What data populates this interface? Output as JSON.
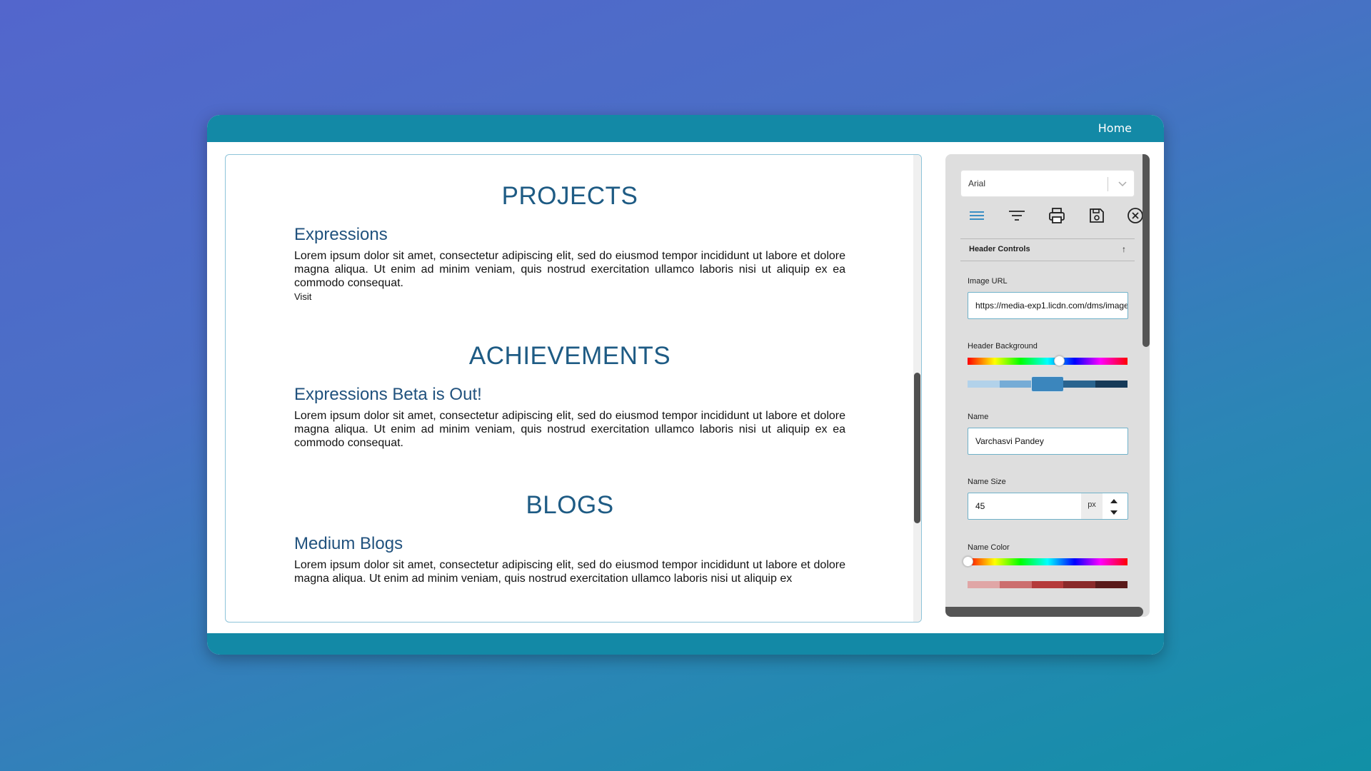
{
  "nav": {
    "home_label": "Home"
  },
  "preview": {
    "sections": [
      {
        "title": "PROJECTS",
        "items": [
          {
            "title": "Expressions",
            "text": "Lorem ipsum dolor sit amet, consectetur adipiscing elit, sed do eiusmod tempor incididunt ut labore et dolore magna aliqua. Ut enim ad minim veniam, quis nostrud exercitation ullamco laboris nisi ut aliquip ex ea commodo consequat.",
            "link": "Visit"
          }
        ]
      },
      {
        "title": "ACHIEVEMENTS",
        "items": [
          {
            "title": "Expressions Beta is Out!",
            "text": "Lorem ipsum dolor sit amet, consectetur adipiscing elit, sed do eiusmod tempor incididunt ut labore et dolore magna aliqua. Ut enim ad minim veniam, quis nostrud exercitation ullamco laboris nisi ut aliquip ex ea commodo consequat."
          }
        ]
      },
      {
        "title": "BLOGS",
        "items": [
          {
            "title": "Medium Blogs",
            "text": "Lorem ipsum dolor sit amet, consectetur adipiscing elit, sed do eiusmod tempor incididunt ut labore et dolore magna aliqua. Ut enim ad minim veniam, quis nostrud exercitation ullamco laboris nisi ut aliquip ex"
          }
        ]
      }
    ]
  },
  "controls": {
    "font_select": {
      "value": "Arial"
    },
    "toolbar_icons": [
      "menu-icon",
      "filter-icon",
      "print-icon",
      "save-icon",
      "close-circle-icon"
    ],
    "section_header": {
      "label": "Header Controls",
      "arrow": "↑"
    },
    "image_url": {
      "label": "Image URL",
      "value": "https://media-exp1.licdn.com/dms/image"
    },
    "header_background": {
      "label": "Header Background",
      "hue_position": 0.57,
      "shades": [
        "#b2d2ea",
        "#76acd6",
        "#3b86bd",
        "#2a648f",
        "#163a58"
      ],
      "selected_shade": 2
    },
    "name": {
      "label": "Name",
      "value": "Varchasvi Pandey"
    },
    "name_size": {
      "label": "Name Size",
      "value": "45",
      "unit": "px"
    },
    "name_color": {
      "label": "Name Color",
      "hue_position": 0.0,
      "shades": [
        "#e0a6a6",
        "#cc6e6e",
        "#b53a3a",
        "#8a2a2a",
        "#5a1a1a"
      ]
    }
  },
  "colors": {
    "accent": "#1389a6",
    "heading": "#1e5b84"
  }
}
